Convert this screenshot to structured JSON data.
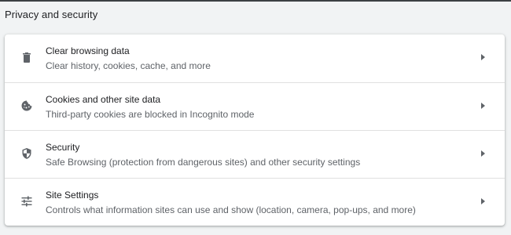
{
  "section": {
    "title": "Privacy and security"
  },
  "rows": [
    {
      "label": "Clear browsing data",
      "description": "Clear history, cookies, cache, and more",
      "icon": "trash-icon"
    },
    {
      "label": "Cookies and other site data",
      "description": "Third-party cookies are blocked in Incognito mode",
      "icon": "cookie-icon"
    },
    {
      "label": "Security",
      "description": "Safe Browsing (protection from dangerous sites) and other security settings",
      "icon": "shield-icon"
    },
    {
      "label": "Site Settings",
      "description": "Controls what information sites can use and show (location, camera, pop-ups, and more)",
      "icon": "sliders-icon"
    }
  ],
  "colors": {
    "page_bg": "#f1f3f4",
    "card_bg": "#ffffff",
    "primary_text": "#202124",
    "secondary_text": "#5f6368",
    "divider": "#e0e0e0"
  }
}
